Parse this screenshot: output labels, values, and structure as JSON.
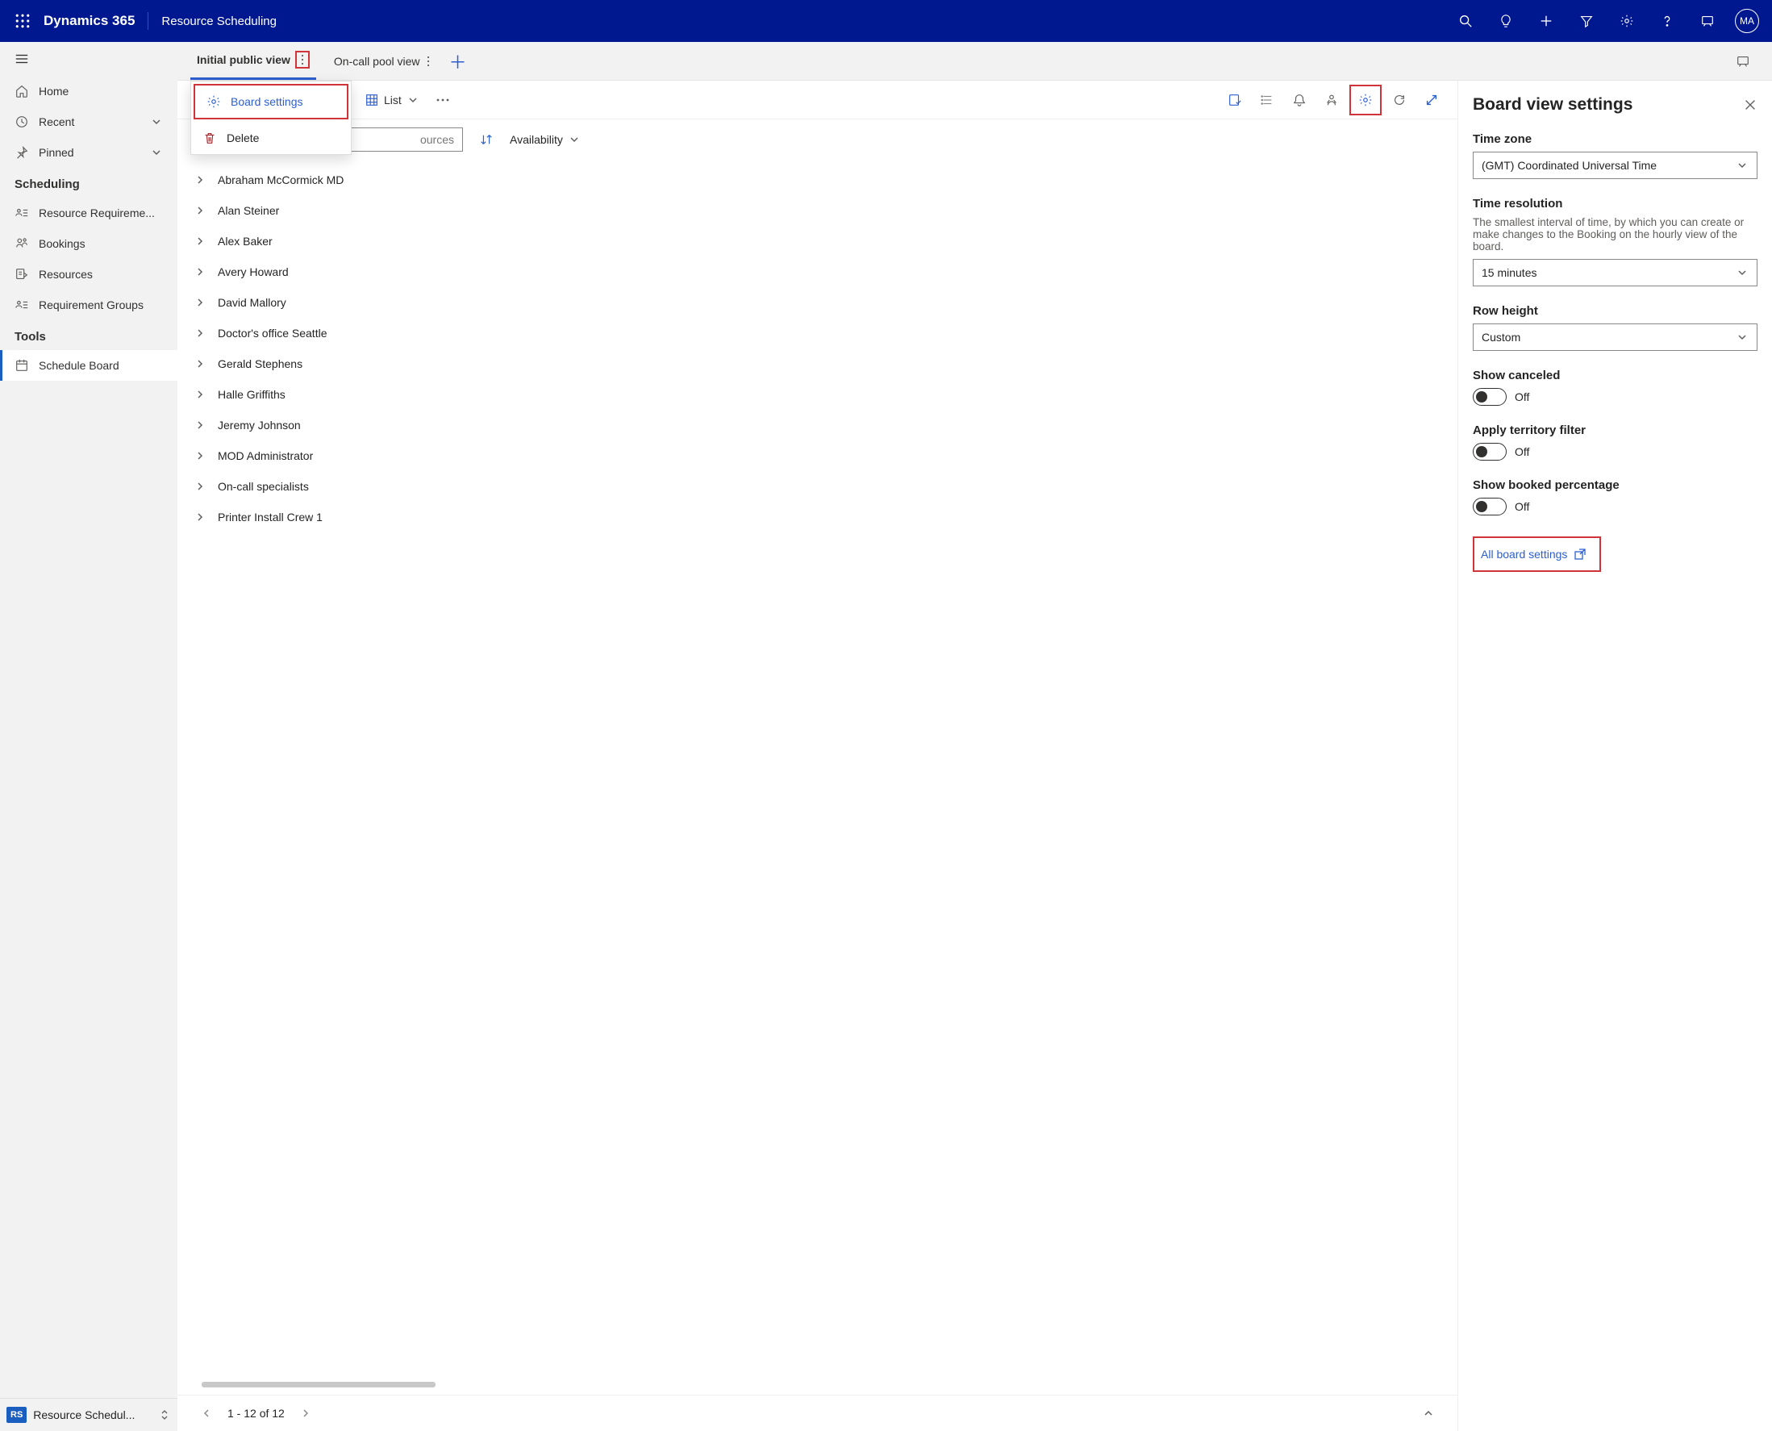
{
  "header": {
    "app_title": "Dynamics 365",
    "module_title": "Resource Scheduling",
    "avatar_initials": "MA"
  },
  "left_nav": {
    "home": "Home",
    "recent": "Recent",
    "pinned": "Pinned",
    "section_scheduling": "Scheduling",
    "resource_requirements": "Resource Requireme...",
    "bookings": "Bookings",
    "resources": "Resources",
    "requirement_groups": "Requirement Groups",
    "section_tools": "Tools",
    "schedule_board": "Schedule Board",
    "bottom_badge": "RS",
    "bottom_text": "Resource Schedul..."
  },
  "tabs": {
    "tab1": "Initial public view",
    "tab2": "On-call pool view",
    "menu_board_settings": "Board settings",
    "menu_delete": "Delete"
  },
  "toolbar": {
    "list_label": "List"
  },
  "filters": {
    "search_placeholder": "ources",
    "sort_label": "Availability"
  },
  "resources": [
    "Abraham McCormick MD",
    "Alan Steiner",
    "Alex Baker",
    "Avery Howard",
    "David Mallory",
    "Doctor's office Seattle",
    "Gerald Stephens",
    "Halle Griffiths",
    "Jeremy Johnson",
    "MOD Administrator",
    "On-call specialists",
    "Printer Install Crew 1"
  ],
  "pagination": {
    "range_text": "1 - 12 of 12"
  },
  "settings_panel": {
    "title": "Board view settings",
    "timezone_label": "Time zone",
    "timezone_value": "(GMT) Coordinated Universal Time",
    "time_resolution_label": "Time resolution",
    "time_resolution_help": "The smallest interval of time, by which you can create or make changes to the Booking on the hourly view of the board.",
    "time_resolution_value": "15 minutes",
    "row_height_label": "Row height",
    "row_height_value": "Custom",
    "show_canceled_label": "Show canceled",
    "show_canceled_value": "Off",
    "territory_label": "Apply territory filter",
    "territory_value": "Off",
    "booked_pct_label": "Show booked percentage",
    "booked_pct_value": "Off",
    "all_board_settings": "All board settings"
  }
}
